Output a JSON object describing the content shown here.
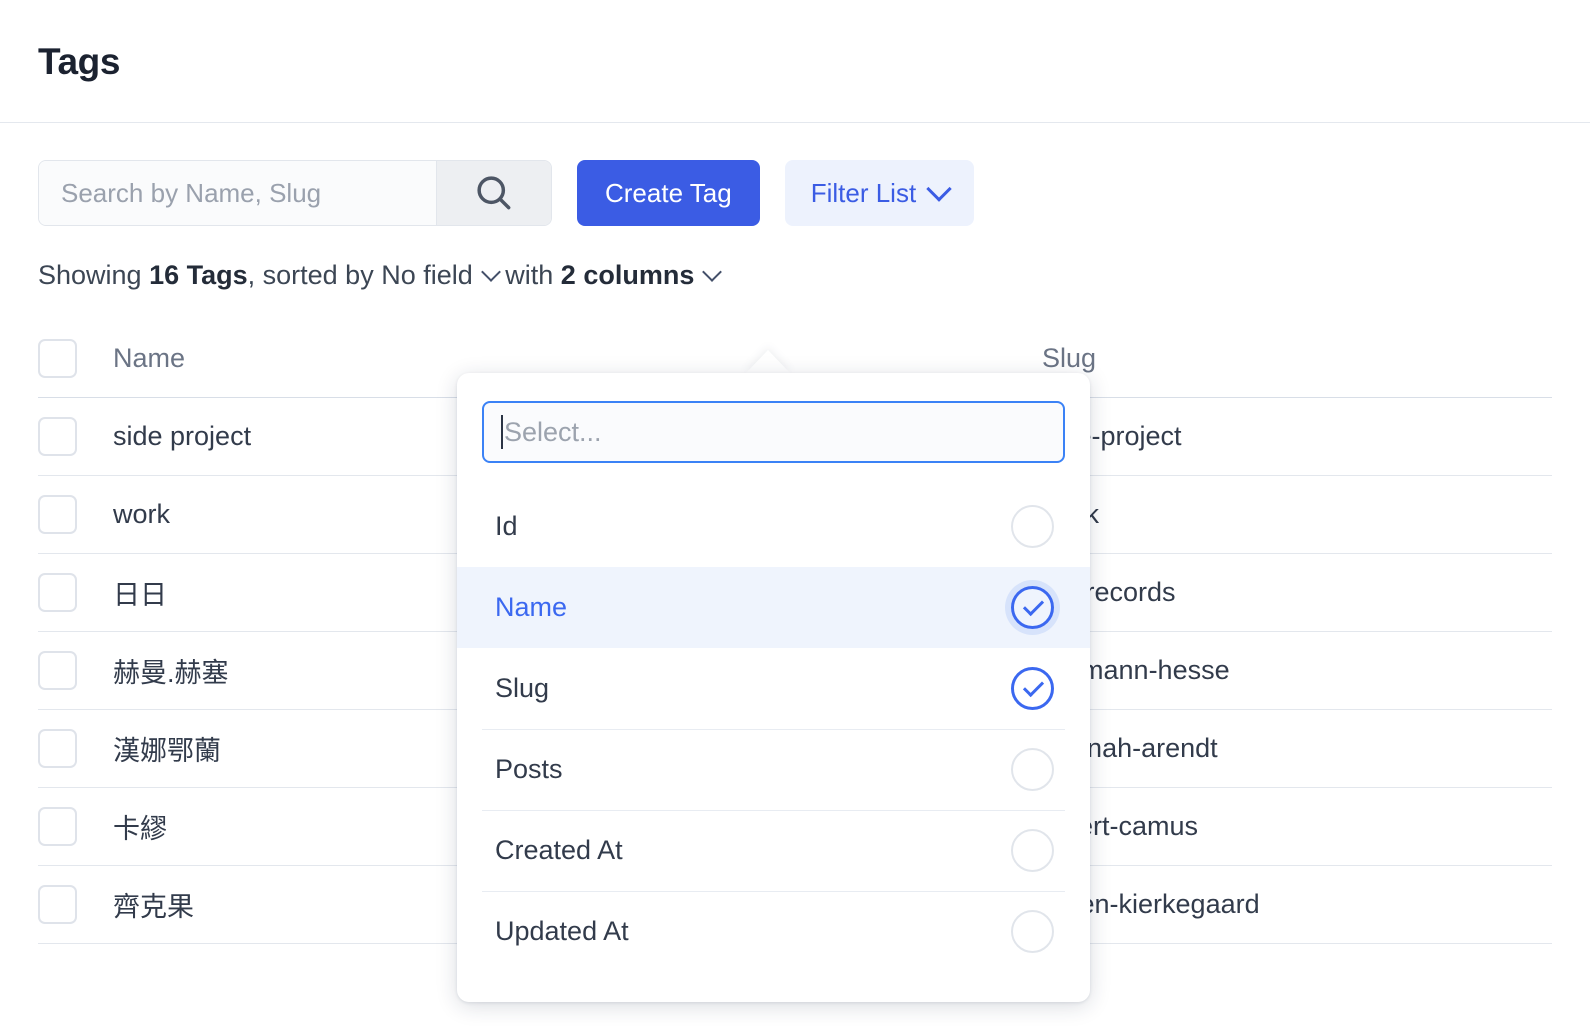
{
  "header": {
    "title": "Tags"
  },
  "toolbar": {
    "search_placeholder": "Search by Name, Slug",
    "search_value": "",
    "search_icon": "search-icon",
    "create_label": "Create Tag",
    "filter_label": "Filter List",
    "filter_chevron": "chevron-down-icon"
  },
  "summary": {
    "prefix": "Showing ",
    "count": "16 Tags",
    "sorted_by_prefix": ", sorted by ",
    "sort_field": "No field",
    "with_text": " with ",
    "columns": "2 columns"
  },
  "table": {
    "columns": [
      "Name",
      "Slug"
    ],
    "rows": [
      {
        "name": "side project",
        "slug": "side-project"
      },
      {
        "name": "work",
        "slug": "work"
      },
      {
        "name": "日日",
        "slug": "life-records"
      },
      {
        "name": "赫曼.赫塞",
        "slug": "hermann-hesse"
      },
      {
        "name": "漢娜鄂蘭",
        "slug": "hannah-arendt"
      },
      {
        "name": "卡繆",
        "slug": "albert-camus"
      },
      {
        "name": "齊克果",
        "slug": "soren-kierkegaard"
      }
    ]
  },
  "popover": {
    "search_placeholder": "Select...",
    "search_value": "",
    "items": [
      {
        "label": "Id",
        "checked": false,
        "active": false
      },
      {
        "label": "Name",
        "checked": true,
        "active": true
      },
      {
        "label": "Slug",
        "checked": true,
        "active": false
      },
      {
        "label": "Posts",
        "checked": false,
        "active": false
      },
      {
        "label": "Created At",
        "checked": false,
        "active": false
      },
      {
        "label": "Updated At",
        "checked": false,
        "active": false
      }
    ]
  },
  "colors": {
    "primary": "#3b5ce4",
    "link": "#3b68f0",
    "soft_bg": "#edf2fd",
    "active_row": "#eff4fd",
    "border": "#e3e7ed",
    "text": "#323b4b",
    "muted": "#6b7485"
  }
}
